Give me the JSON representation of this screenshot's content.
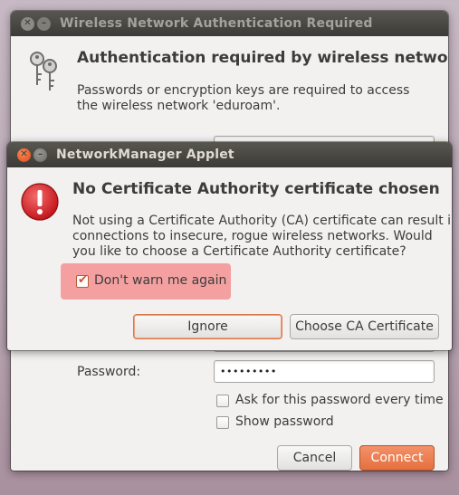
{
  "auth_dialog": {
    "title": "Wireless Network Authentication Required",
    "heading": "Authentication required by wireless network",
    "description_line1": "Passwords or encryption keys are required to access",
    "description_line2": "the wireless network 'eduroam'.",
    "icon": "keys-icon",
    "password_label": "Password:",
    "password_value": "•••••••••",
    "ask_every_time_label": "Ask for this password every time",
    "ask_every_time_checked": false,
    "show_password_label": "Show password",
    "show_password_checked": false,
    "cancel_label": "Cancel",
    "connect_label": "Connect"
  },
  "warning_dialog": {
    "title": "NetworkManager Applet",
    "heading": "No Certificate Authority certificate chosen",
    "icon": "error-icon",
    "message_line1": "Not using a Certificate Authority (CA) certificate can result in",
    "message_line2": "connections to insecure, rogue wireless networks.  Would",
    "message_line3": "you like to choose a Certificate Authority certificate?",
    "dont_warn_label": "Don't warn me again",
    "dont_warn_checked": true,
    "ignore_label": "Ignore",
    "choose_ca_label": "Choose CA Certificate"
  },
  "colors": {
    "accent": "#e5703f",
    "highlight": "#f4a0a0",
    "titlebar": "#3c3b37"
  }
}
